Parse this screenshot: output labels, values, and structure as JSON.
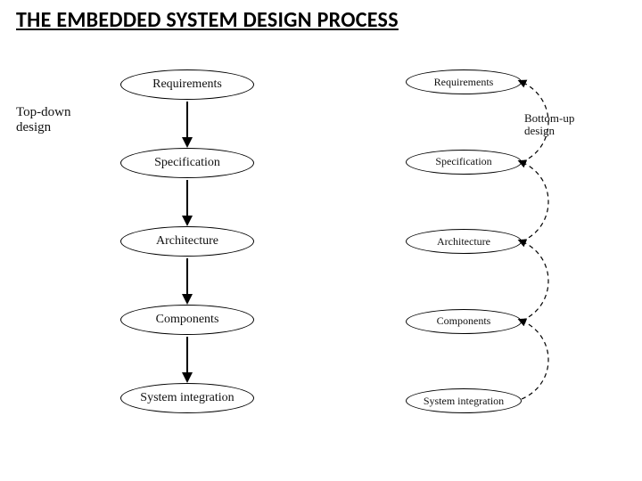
{
  "title": "THE EMBEDDED SYSTEM DESIGN PROCESS",
  "left": {
    "label": "Top-down design",
    "steps": [
      "Requirements",
      "Specification",
      "Architecture",
      "Components",
      "System integration"
    ]
  },
  "right": {
    "label": "Bottom-up design",
    "steps": [
      "Requirements",
      "Specification",
      "Architecture",
      "Components",
      "System integration"
    ]
  }
}
